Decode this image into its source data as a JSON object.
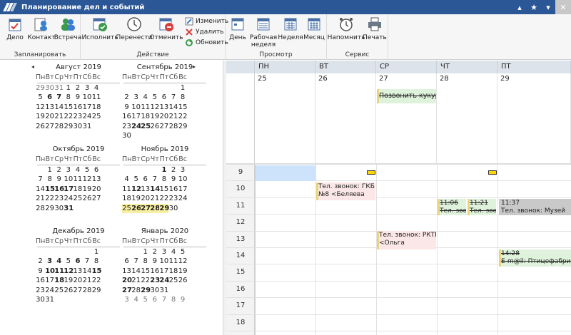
{
  "window": {
    "title": "Планирование дел и событий"
  },
  "ribbon": {
    "groups": [
      {
        "label": "Запланировать",
        "buttons": [
          "Дело",
          "Контакт",
          "Встреча"
        ]
      },
      {
        "label": "Действие",
        "buttons": [
          "Исполнить",
          "Перенести",
          "Отменить"
        ],
        "small": [
          "Изменить",
          "Удалить",
          "Обновить"
        ]
      },
      {
        "label": "Просмотр",
        "buttons": [
          "День",
          "Рабочая неделя",
          "Неделя",
          "Месяц"
        ]
      },
      {
        "label": "Сервис",
        "buttons": [
          "Напомнить",
          "Печать"
        ]
      }
    ],
    "work_week_line1": "Рабочая",
    "work_week_line2": "неделя"
  },
  "mini_calendars": {
    "weekdays": [
      "Пн",
      "Вт",
      "Ср",
      "Чт",
      "Пт",
      "Сб",
      "Вс"
    ],
    "months": [
      {
        "title": "Август 2019",
        "rows": [
          [
            [
              "29",
              "g"
            ],
            [
              "30",
              "g"
            ],
            [
              "31",
              "g"
            ],
            [
              "1",
              ""
            ],
            [
              "2",
              ""
            ],
            [
              "3",
              ""
            ],
            [
              "4",
              ""
            ]
          ],
          [
            [
              "5",
              ""
            ],
            [
              "6",
              "b"
            ],
            [
              "7",
              "b"
            ],
            [
              "8",
              ""
            ],
            [
              "9",
              ""
            ],
            [
              "10",
              ""
            ],
            [
              "11",
              ""
            ]
          ],
          [
            [
              "12",
              ""
            ],
            [
              "13",
              ""
            ],
            [
              "14",
              ""
            ],
            [
              "15",
              ""
            ],
            [
              "16",
              ""
            ],
            [
              "17",
              ""
            ],
            [
              "18",
              ""
            ]
          ],
          [
            [
              "19",
              ""
            ],
            [
              "20",
              ""
            ],
            [
              "21",
              ""
            ],
            [
              "22",
              ""
            ],
            [
              "23",
              ""
            ],
            [
              "24",
              ""
            ],
            [
              "25",
              ""
            ]
          ],
          [
            [
              "26",
              ""
            ],
            [
              "27",
              ""
            ],
            [
              "28",
              ""
            ],
            [
              "29",
              ""
            ],
            [
              "30",
              ""
            ],
            [
              "31",
              ""
            ],
            [
              "",
              ""
            ]
          ]
        ]
      },
      {
        "title": "Сентябрь 2019",
        "rows": [
          [
            [
              "",
              ""
            ],
            [
              "",
              ""
            ],
            [
              "",
              ""
            ],
            [
              "",
              ""
            ],
            [
              "",
              ""
            ],
            [
              "",
              ""
            ],
            [
              "1",
              ""
            ]
          ],
          [
            [
              "2",
              ""
            ],
            [
              "3",
              ""
            ],
            [
              "4",
              ""
            ],
            [
              "5",
              ""
            ],
            [
              "6",
              ""
            ],
            [
              "7",
              ""
            ],
            [
              "8",
              ""
            ]
          ],
          [
            [
              "9",
              ""
            ],
            [
              "10",
              ""
            ],
            [
              "11",
              ""
            ],
            [
              "12",
              ""
            ],
            [
              "13",
              ""
            ],
            [
              "14",
              ""
            ],
            [
              "15",
              ""
            ]
          ],
          [
            [
              "16",
              ""
            ],
            [
              "17",
              ""
            ],
            [
              "18",
              ""
            ],
            [
              "19",
              ""
            ],
            [
              "20",
              ""
            ],
            [
              "21",
              ""
            ],
            [
              "22",
              ""
            ]
          ],
          [
            [
              "23",
              ""
            ],
            [
              "24",
              "b"
            ],
            [
              "25",
              "b"
            ],
            [
              "26",
              ""
            ],
            [
              "27",
              ""
            ],
            [
              "28",
              ""
            ],
            [
              "29",
              ""
            ]
          ],
          [
            [
              "30",
              ""
            ],
            [
              "",
              ""
            ],
            [
              "",
              ""
            ],
            [
              "",
              ""
            ],
            [
              "",
              ""
            ],
            [
              "",
              ""
            ],
            [
              "",
              ""
            ]
          ]
        ]
      },
      {
        "title": "Октябрь 2019",
        "rows": [
          [
            [
              "",
              ""
            ],
            [
              "1",
              ""
            ],
            [
              "2",
              ""
            ],
            [
              "3",
              ""
            ],
            [
              "4",
              ""
            ],
            [
              "5",
              ""
            ],
            [
              "6",
              ""
            ]
          ],
          [
            [
              "7",
              ""
            ],
            [
              "8",
              ""
            ],
            [
              "9",
              ""
            ],
            [
              "10",
              ""
            ],
            [
              "11",
              ""
            ],
            [
              "12",
              ""
            ],
            [
              "13",
              ""
            ]
          ],
          [
            [
              "14",
              ""
            ],
            [
              "15",
              "b"
            ],
            [
              "16",
              "b"
            ],
            [
              "17",
              "b"
            ],
            [
              "18",
              ""
            ],
            [
              "19",
              ""
            ],
            [
              "20",
              ""
            ]
          ],
          [
            [
              "21",
              ""
            ],
            [
              "22",
              ""
            ],
            [
              "23",
              ""
            ],
            [
              "24",
              ""
            ],
            [
              "25",
              ""
            ],
            [
              "26",
              ""
            ],
            [
              "27",
              ""
            ]
          ],
          [
            [
              "28",
              ""
            ],
            [
              "29",
              ""
            ],
            [
              "30",
              ""
            ],
            [
              "31",
              "b"
            ],
            [
              "",
              ""
            ],
            [
              "",
              ""
            ],
            [
              "",
              ""
            ]
          ]
        ]
      },
      {
        "title": "Ноябрь 2019",
        "rows": [
          [
            [
              "",
              ""
            ],
            [
              "",
              ""
            ],
            [
              "",
              ""
            ],
            [
              "",
              ""
            ],
            [
              "1",
              "b"
            ],
            [
              "2",
              ""
            ],
            [
              "3",
              ""
            ]
          ],
          [
            [
              "4",
              ""
            ],
            [
              "5",
              ""
            ],
            [
              "6",
              ""
            ],
            [
              "7",
              ""
            ],
            [
              "8",
              ""
            ],
            [
              "9",
              ""
            ],
            [
              "10",
              ""
            ]
          ],
          [
            [
              "11",
              ""
            ],
            [
              "12",
              "b"
            ],
            [
              "13",
              ""
            ],
            [
              "14",
              "b"
            ],
            [
              "15",
              ""
            ],
            [
              "16",
              ""
            ],
            [
              "17",
              ""
            ]
          ],
          [
            [
              "18",
              ""
            ],
            [
              "19",
              ""
            ],
            [
              "20",
              ""
            ],
            [
              "21",
              ""
            ],
            [
              "22",
              ""
            ],
            [
              "23",
              ""
            ],
            [
              "24",
              ""
            ]
          ],
          [
            [
              "25",
              "sel"
            ],
            [
              "26",
              "b sel"
            ],
            [
              "27",
              "b sel"
            ],
            [
              "28",
              "b sel"
            ],
            [
              "29",
              "b sel"
            ],
            [
              "30",
              ""
            ],
            [
              "",
              ""
            ]
          ]
        ]
      },
      {
        "title": "Декабрь 2019",
        "rows": [
          [
            [
              "",
              ""
            ],
            [
              "",
              ""
            ],
            [
              "",
              ""
            ],
            [
              "",
              ""
            ],
            [
              "",
              ""
            ],
            [
              "",
              ""
            ],
            [
              "1",
              ""
            ]
          ],
          [
            [
              "2",
              ""
            ],
            [
              "3",
              "b"
            ],
            [
              "4",
              "b"
            ],
            [
              "5",
              ""
            ],
            [
              "6",
              "b"
            ],
            [
              "7",
              ""
            ],
            [
              "8",
              ""
            ]
          ],
          [
            [
              "9",
              ""
            ],
            [
              "10",
              "b"
            ],
            [
              "11",
              "b"
            ],
            [
              "12",
              "b"
            ],
            [
              "13",
              ""
            ],
            [
              "14",
              ""
            ],
            [
              "15",
              "b"
            ]
          ],
          [
            [
              "16",
              ""
            ],
            [
              "17",
              ""
            ],
            [
              "18",
              "b"
            ],
            [
              "19",
              ""
            ],
            [
              "20",
              ""
            ],
            [
              "21",
              ""
            ],
            [
              "22",
              ""
            ]
          ],
          [
            [
              "23",
              ""
            ],
            [
              "24",
              ""
            ],
            [
              "25",
              ""
            ],
            [
              "26",
              ""
            ],
            [
              "27",
              ""
            ],
            [
              "28",
              ""
            ],
            [
              "29",
              ""
            ]
          ],
          [
            [
              "30",
              ""
            ],
            [
              "31",
              ""
            ],
            [
              "",
              ""
            ],
            [
              "",
              ""
            ],
            [
              "",
              ""
            ],
            [
              "",
              ""
            ],
            [
              "",
              ""
            ]
          ]
        ]
      },
      {
        "title": "Январь 2020",
        "rows": [
          [
            [
              "",
              ""
            ],
            [
              "",
              ""
            ],
            [
              "1",
              ""
            ],
            [
              "2",
              ""
            ],
            [
              "3",
              ""
            ],
            [
              "4",
              ""
            ],
            [
              "5",
              ""
            ]
          ],
          [
            [
              "6",
              ""
            ],
            [
              "7",
              ""
            ],
            [
              "8",
              ""
            ],
            [
              "9",
              ""
            ],
            [
              "10",
              ""
            ],
            [
              "11",
              ""
            ],
            [
              "12",
              ""
            ]
          ],
          [
            [
              "13",
              ""
            ],
            [
              "14",
              ""
            ],
            [
              "15",
              ""
            ],
            [
              "16",
              ""
            ],
            [
              "17",
              ""
            ],
            [
              "18",
              ""
            ],
            [
              "19",
              ""
            ]
          ],
          [
            [
              "20",
              "b"
            ],
            [
              "21",
              ""
            ],
            [
              "22",
              ""
            ],
            [
              "23",
              "b"
            ],
            [
              "24",
              "b"
            ],
            [
              "25",
              ""
            ],
            [
              "26",
              ""
            ]
          ],
          [
            [
              "27",
              "b"
            ],
            [
              "28",
              ""
            ],
            [
              "29",
              "b"
            ],
            [
              "30",
              ""
            ],
            [
              "31",
              ""
            ],
            [
              "",
              ""
            ],
            [
              "",
              ""
            ]
          ],
          [
            [
              "3",
              "g"
            ],
            [
              "4",
              "g"
            ],
            [
              "5",
              "g"
            ],
            [
              "6",
              "g"
            ],
            [
              "7",
              "g"
            ],
            [
              "8",
              "g"
            ],
            [
              "9",
              "g"
            ]
          ]
        ]
      }
    ]
  },
  "week_view": {
    "days": [
      {
        "abbr": "ПН",
        "date": "25"
      },
      {
        "abbr": "ВТ",
        "date": "26"
      },
      {
        "abbr": "СР",
        "date": "27"
      },
      {
        "abbr": "ЧТ",
        "date": "28"
      },
      {
        "abbr": "ПТ",
        "date": "29"
      }
    ],
    "hours": [
      "9",
      "10",
      "11",
      "12",
      "13",
      "14",
      "15",
      "16",
      "17",
      "18"
    ],
    "allday_event": {
      "text": "Позвонить кукурузникам"
    },
    "events": [
      {
        "id": "tue_gkb",
        "line1": "Тел. звонок: ГКБ",
        "line2": "№8 <Беляева"
      },
      {
        "id": "thu_a",
        "line1": "11:06",
        "line2": "Тел. звон"
      },
      {
        "id": "thu_b",
        "line1": "11:21",
        "line2": "Тел. зво"
      },
      {
        "id": "fri_muz",
        "line1": "11:37",
        "line2": "Тел. звонок: Музей"
      },
      {
        "id": "wed_rktb",
        "line1": "Тел. звонок: РКТБ",
        "line2": "<Ольга"
      },
      {
        "id": "fri_email",
        "line1": "14:28",
        "line2": "E-m@il: Птицефабрика"
      }
    ]
  }
}
